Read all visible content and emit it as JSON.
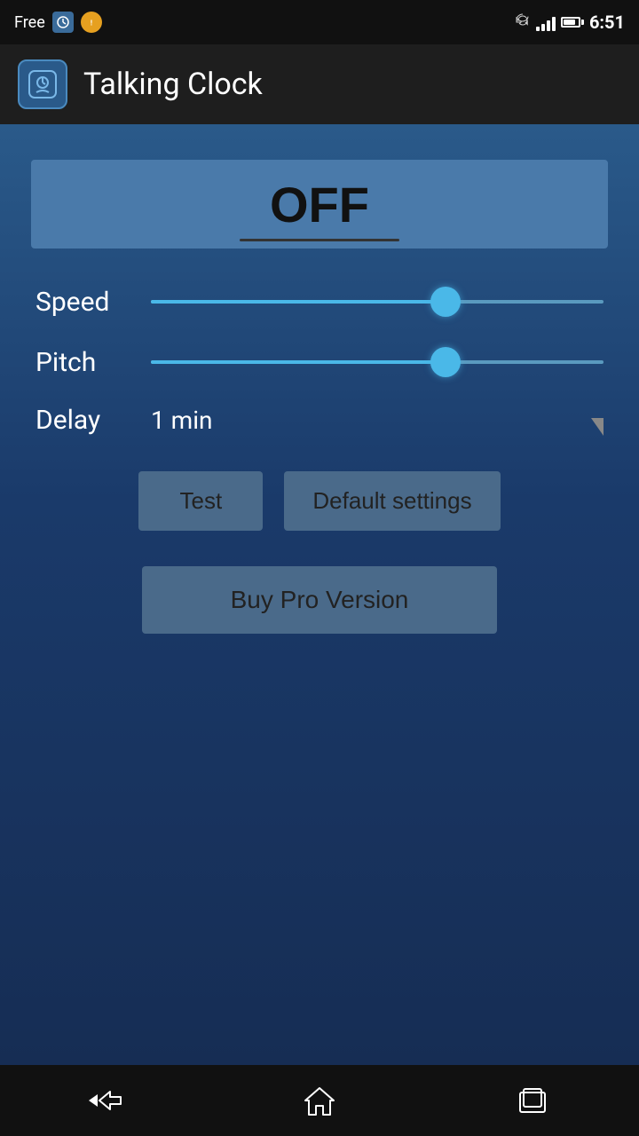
{
  "statusBar": {
    "free": "Free",
    "time": "6:51"
  },
  "appBar": {
    "title": "Talking Clock"
  },
  "main": {
    "powerState": "OFF",
    "speedLabel": "Speed",
    "speedValue": 65,
    "pitchLabel": "Pitch",
    "pitchValue": 65,
    "delayLabel": "Delay",
    "delayValue": "1 min",
    "testButton": "Test",
    "defaultButton": "Default settings",
    "proButton": "Buy Pro Version"
  },
  "nav": {
    "back": "back",
    "home": "home",
    "recents": "recents"
  }
}
